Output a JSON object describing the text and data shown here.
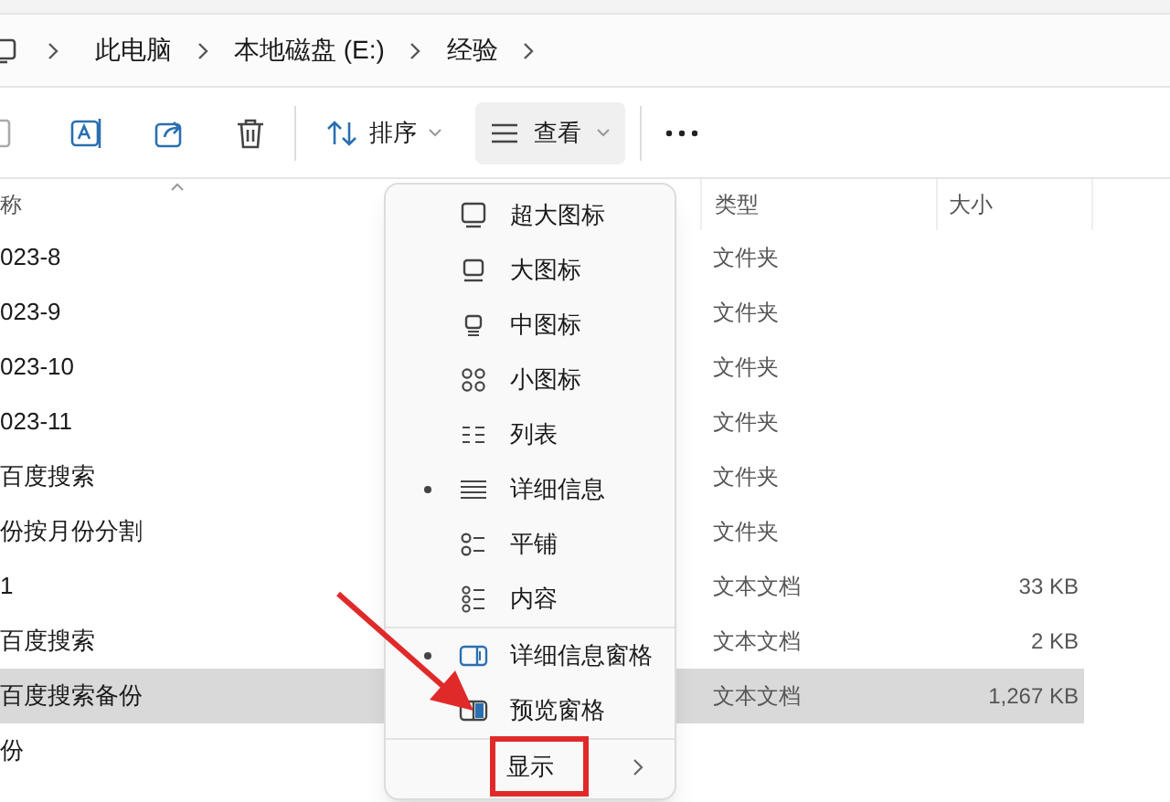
{
  "breadcrumb": [
    "此电脑",
    "本地磁盘 (E:)",
    "经验"
  ],
  "toolbar": {
    "sort_label": "排序",
    "view_label": "查看",
    "view_pressed": true
  },
  "columns": [
    "称",
    "类型",
    "大小"
  ],
  "rows": [
    {
      "name": "023-8",
      "type": "文件夹",
      "size": "",
      "selected": false
    },
    {
      "name": "023-9",
      "type": "文件夹",
      "size": "",
      "selected": false
    },
    {
      "name": "023-10",
      "type": "文件夹",
      "size": "",
      "selected": false
    },
    {
      "name": "023-11",
      "type": "文件夹",
      "size": "",
      "selected": false
    },
    {
      "name": "百度搜索",
      "type": "文件夹",
      "size": "",
      "selected": false
    },
    {
      "name": "份按月份分割",
      "type": "文件夹",
      "size": "",
      "selected": false
    },
    {
      "name": "1",
      "type": "文本文档",
      "size": "33 KB",
      "selected": false
    },
    {
      "name": "百度搜索",
      "type": "文本文档",
      "size": "2 KB",
      "selected": false
    },
    {
      "name": "百度搜索备份",
      "type": "文本文档",
      "size": "1,267 KB",
      "selected": true
    },
    {
      "name": "份",
      "type": "",
      "size": "",
      "selected": false
    }
  ],
  "view_menu": {
    "layouts": [
      {
        "label": "超大图标",
        "selected": false
      },
      {
        "label": "大图标",
        "selected": false
      },
      {
        "label": "中图标",
        "selected": false
      },
      {
        "label": "小图标",
        "selected": false
      },
      {
        "label": "列表",
        "selected": false
      },
      {
        "label": "详细信息",
        "selected": true
      },
      {
        "label": "平铺",
        "selected": false
      },
      {
        "label": "内容",
        "selected": false
      }
    ],
    "panes": [
      {
        "label": "详细信息窗格",
        "selected": true
      },
      {
        "label": "预览窗格",
        "selected": false
      }
    ],
    "show": {
      "label": "显示",
      "boxed": true
    }
  },
  "annotation_arrow": true
}
